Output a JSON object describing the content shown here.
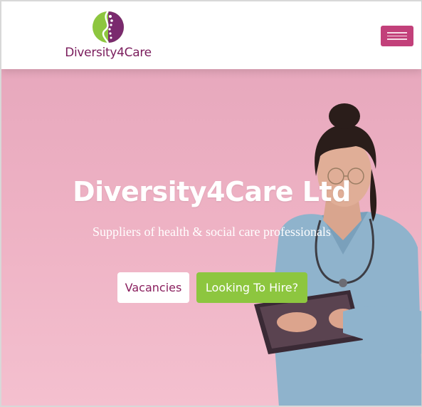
{
  "brand": {
    "logo_text": "Diversity4Care",
    "colors": {
      "magenta": "#c2407a",
      "plum": "#7a1c5c",
      "green": "#8dc63f",
      "hero_pink": "#eeb2c4"
    }
  },
  "header": {
    "menu_icon": "hamburger-menu-icon"
  },
  "hero": {
    "title": "Diversity4Care Ltd",
    "subtitle": "Suppliers of health & social care professionals",
    "buttons": {
      "vacancies": "Vacancies",
      "hire": "Looking To Hire?"
    }
  }
}
